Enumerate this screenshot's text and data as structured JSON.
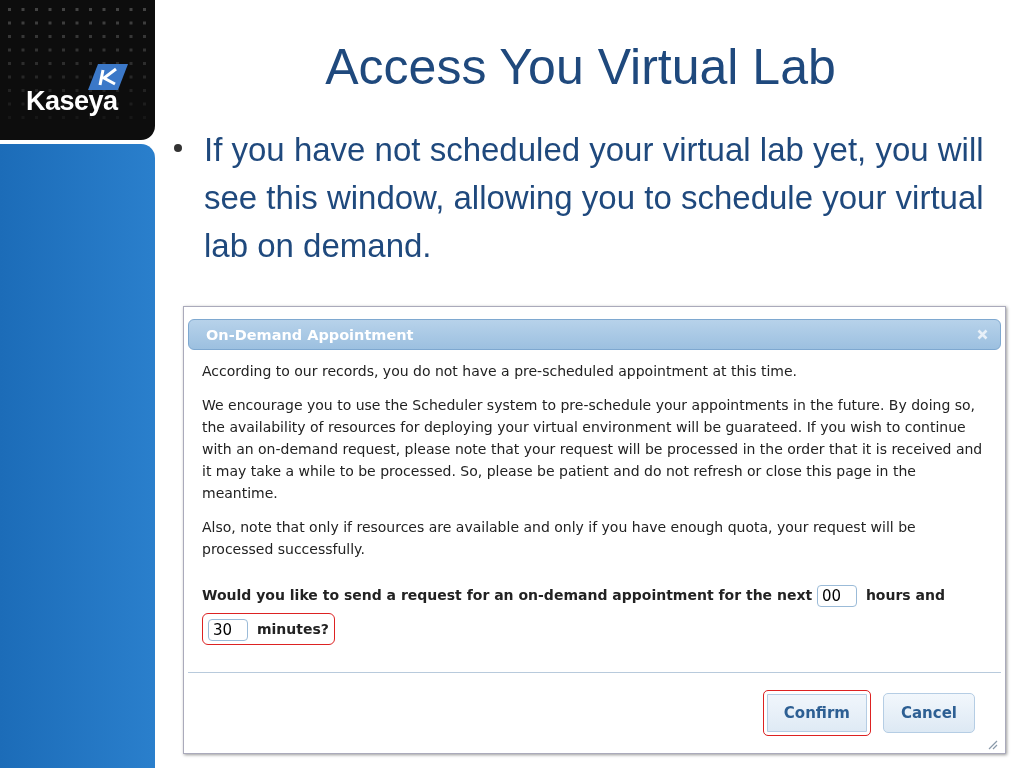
{
  "logo": {
    "text": "Kaseya"
  },
  "slide": {
    "title": "Access You Virtual Lab",
    "bullets": [
      "If you have not scheduled your virtual lab yet, you will see this window, allowing you to schedule your virtual lab on demand."
    ]
  },
  "dialog": {
    "title": "On-Demand Appointment",
    "paragraphs": [
      "According to our records, you do not have a pre-scheduled appointment at this time.",
      "We encourage you to use the Scheduler system to pre-schedule your appointments in the future. By doing so, the availability of resources for deploying your virtual environment will be guarateed. If you wish to continue with an on-demand request, please note that your request will be processed in the order that it is received and it may take a while to be processed. So, please be patient and do not refresh or close this page in the meantime.",
      "Also, note that only if resources are available and only if you have enough quota, your request will be processed successfully."
    ],
    "question": {
      "before": "Would you like to send a request for an on-demand appointment for the next",
      "hours_value": "00",
      "middle": "hours and",
      "minutes_value": "30",
      "after": "minutes?",
      "highlighted": true
    },
    "buttons": [
      {
        "label": "Confirm",
        "highlighted": true
      },
      {
        "label": "Cancel",
        "highlighted": false
      }
    ]
  }
}
